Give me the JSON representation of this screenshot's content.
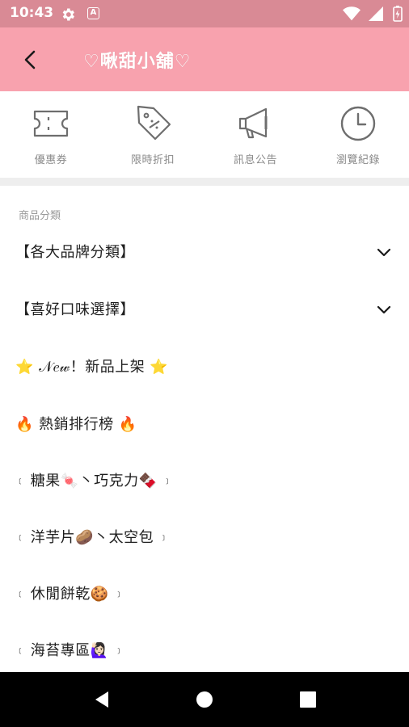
{
  "status_bar": {
    "time": "10:43",
    "notification_icon_letter": "A",
    "background": "#d98a95"
  },
  "app_bar": {
    "title": "♡啾甜小舖♡",
    "background": "#f8a2ae"
  },
  "quick_actions": [
    {
      "label": "優惠券",
      "icon": "ticket-icon"
    },
    {
      "label": "限時折扣",
      "icon": "discount-tag-icon"
    },
    {
      "label": "訊息公告",
      "icon": "megaphone-icon"
    },
    {
      "label": "瀏覽紀錄",
      "icon": "clock-icon"
    }
  ],
  "categories": {
    "header": "商品分類",
    "items": [
      {
        "label": "【各大品牌分類】",
        "expandable": true
      },
      {
        "label": "【喜好口味選擇】",
        "expandable": true
      },
      {
        "label": "⭐ 𝒩𝑒𝓌！新品上架 ⭐",
        "expandable": false
      },
      {
        "label": "🔥 熱銷排行榜 🔥",
        "expandable": false
      },
      {
        "open": "﹝",
        "label": "糖果🍬丶巧克力🍫",
        "close": "﹞",
        "expandable": false
      },
      {
        "open": "﹝",
        "label": "洋芋片🥔丶太空包",
        "close": "﹞",
        "expandable": false
      },
      {
        "open": "﹝",
        "label": "休閒餅乾🍪",
        "close": "﹞",
        "expandable": false
      },
      {
        "open": "﹝",
        "label": "海苔專區🙋🏻‍♀️",
        "close": "﹞",
        "expandable": false
      }
    ]
  },
  "nav_bar": {
    "buttons": [
      "back-triangle",
      "home-circle",
      "recents-square"
    ]
  }
}
